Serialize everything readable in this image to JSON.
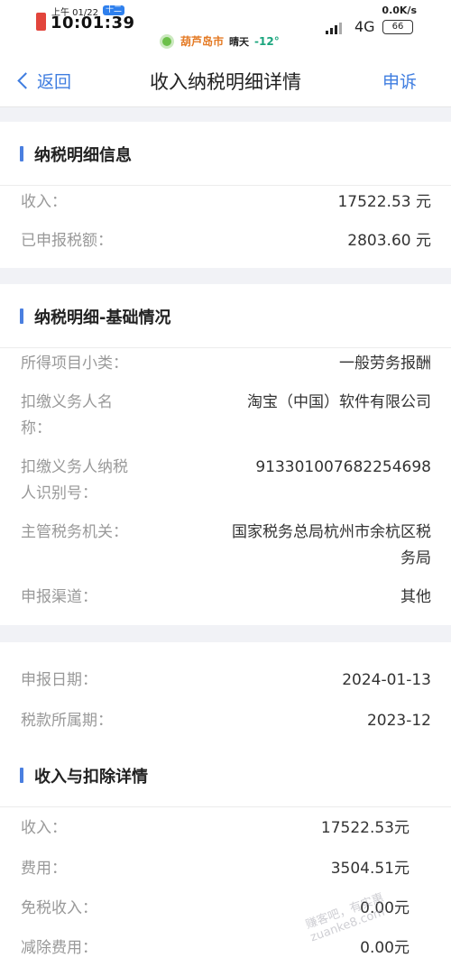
{
  "status_bar": {
    "ampm_date": "上午 01/22",
    "lunar_badge": "十二",
    "time": "10:01:39",
    "city": "葫芦岛市",
    "weather": "晴天",
    "temperature": "-12°",
    "net_speed": "0.0K/s",
    "network": "4G",
    "battery": "66"
  },
  "nav": {
    "back": "返回",
    "title": "收入纳税明细详情",
    "appeal": "申诉"
  },
  "section1": {
    "title": "纳税明细信息",
    "rows": [
      {
        "k": "收入：",
        "v": "17522.53 元"
      },
      {
        "k": "已申报税额：",
        "v": "2803.60 元"
      }
    ]
  },
  "section2": {
    "title": "纳税明细-基础情况",
    "rows": [
      {
        "k": "所得项目小类：",
        "v": "一般劳务报酬"
      },
      {
        "k1": "扣缴义务人名",
        "k2": "称：",
        "v": "淘宝（中国）软件有限公司"
      },
      {
        "k1": "扣缴义务人纳税",
        "k2": "人识别号：",
        "v": "91330100768225469​8"
      },
      {
        "k": "主管税务机关：",
        "v1": "国家税务总局杭州市余杭区税",
        "v2": "务局"
      },
      {
        "k": "申报渠道：",
        "v": "其他"
      }
    ]
  },
  "section3": {
    "rows": [
      {
        "k": "申报日期：",
        "v": "2024-01-13"
      },
      {
        "k": "税款所属期：",
        "v": "2023-12"
      }
    ]
  },
  "section4": {
    "title": "收入与扣除详情",
    "rows": [
      {
        "k": "收入：",
        "v": "17522.53元"
      },
      {
        "k": "费用：",
        "v": "3504.51元"
      },
      {
        "k": "免税收入：",
        "v": "0.00元"
      },
      {
        "k": "减除费用：",
        "v": "0.00元"
      }
    ]
  },
  "watermark": "赚客吧，有实惠 zuanke8.com"
}
